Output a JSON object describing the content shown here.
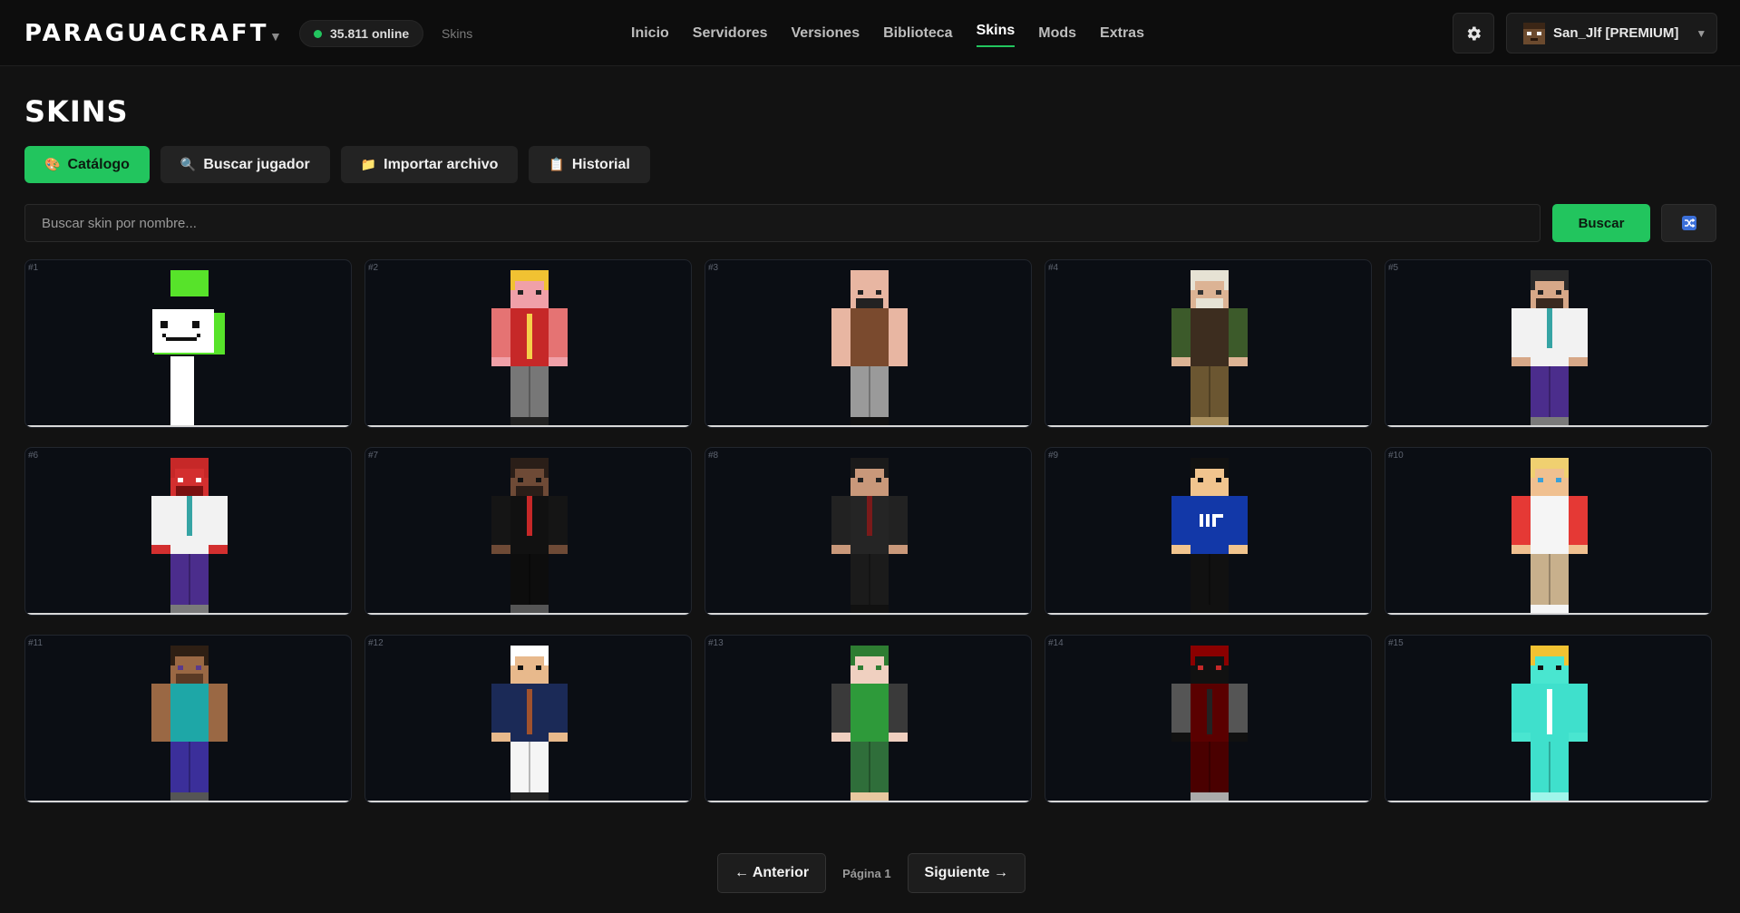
{
  "header": {
    "brand": "PARAGUACRAFT",
    "brand_caret": "▼",
    "online_text": "35.811 online",
    "breadcrumb": "Skins",
    "nav": [
      {
        "label": "Inicio",
        "active": false
      },
      {
        "label": "Servidores",
        "active": false
      },
      {
        "label": "Versiones",
        "active": false
      },
      {
        "label": "Biblioteca",
        "active": false
      },
      {
        "label": "Skins",
        "active": true
      },
      {
        "label": "Mods",
        "active": false
      },
      {
        "label": "Extras",
        "active": false
      }
    ],
    "user": "San_Jlf [PREMIUM]",
    "user_caret": "▼"
  },
  "page": {
    "title": "SKINS",
    "tabs": [
      {
        "icon": "🎨",
        "label": "Catálogo",
        "active": true
      },
      {
        "icon": "🔍",
        "label": "Buscar jugador",
        "active": false
      },
      {
        "icon": "📁",
        "label": "Importar archivo",
        "active": false
      },
      {
        "icon": "📋",
        "label": "Historial",
        "active": false
      }
    ],
    "search_placeholder": "Buscar skin por nombre...",
    "search_button": "Buscar"
  },
  "skins": [
    {
      "num": "#1",
      "style": "dream"
    },
    {
      "num": "#2",
      "style": "technoblade"
    },
    {
      "num": "#3",
      "style": "bald-beard"
    },
    {
      "num": "#4",
      "style": "old-soldier"
    },
    {
      "num": "#5",
      "style": "doctor"
    },
    {
      "num": "#6",
      "style": "red-monster-doctor"
    },
    {
      "num": "#7",
      "style": "suit-red-tie"
    },
    {
      "num": "#8",
      "style": "dark-suit"
    },
    {
      "num": "#9",
      "style": "blue-shirt"
    },
    {
      "num": "#10",
      "style": "blonde-red"
    },
    {
      "num": "#11",
      "style": "steve"
    },
    {
      "num": "#12",
      "style": "pirate"
    },
    {
      "num": "#13",
      "style": "green-girl"
    },
    {
      "num": "#14",
      "style": "red-hood"
    },
    {
      "num": "#15",
      "style": "diamond"
    }
  ],
  "pagination": {
    "prev": "← Anterior",
    "page_label": "Página 1",
    "next": "Siguiente →"
  },
  "colors": {
    "accent": "#22c55e",
    "background": "#121212",
    "card": "#0b0e14"
  },
  "icons": {
    "settings": "gear-icon",
    "shuffle": "shuffle-icon",
    "online": "status-dot"
  }
}
